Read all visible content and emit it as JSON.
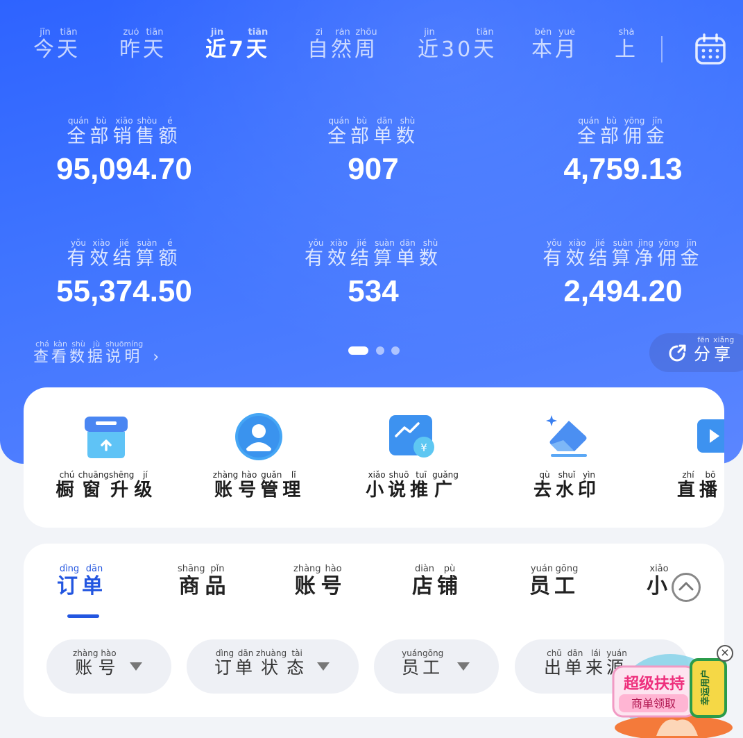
{
  "period_tabs": [
    {
      "label": "今天",
      "pinyin": [
        "jīn",
        "tiān"
      ]
    },
    {
      "label": "昨天",
      "pinyin": [
        "zuó",
        "tiān"
      ]
    },
    {
      "label": "近7天",
      "pinyin": [
        "jìn",
        "",
        "tiān"
      ]
    },
    {
      "label": "自然周",
      "pinyin": [
        "zì",
        "rán",
        "zhōu"
      ]
    },
    {
      "label": "近30天",
      "pinyin": [
        "jìn",
        "",
        "tiān"
      ]
    },
    {
      "label": "本月",
      "pinyin": [
        "běn",
        "yuè"
      ]
    },
    {
      "label": "上",
      "pinyin": [
        "shà"
      ]
    }
  ],
  "active_period": "近7天",
  "metrics": [
    {
      "label": "全部销售额",
      "pinyin": [
        "quán",
        "bù",
        "xiāo",
        "shòu",
        "é"
      ],
      "value": "95,094.70"
    },
    {
      "label": "全部单数",
      "pinyin": [
        "quán",
        "bù",
        "dān",
        "shù"
      ],
      "value": "907"
    },
    {
      "label": "全部佣金",
      "pinyin": [
        "quán",
        "bù",
        "yōng",
        "jīn"
      ],
      "value": "4,759.13"
    },
    {
      "label": "有效结算额",
      "pinyin": [
        "yǒu",
        "xiào",
        "jié",
        "suàn",
        "é"
      ],
      "value": "55,374.50"
    },
    {
      "label": "有效结算单数",
      "pinyin": [
        "yǒu",
        "xiào",
        "jié",
        "suàn",
        "dān",
        "shù"
      ],
      "value": "534"
    },
    {
      "label": "有效结算净佣金",
      "pinyin": [
        "yǒu",
        "xiào",
        "jié",
        "suàn",
        "jìng",
        "yōng",
        "jīn"
      ],
      "value": "2,494.20"
    }
  ],
  "data_note": {
    "label": "查看数据说明",
    "pinyin": [
      "chá",
      "kàn",
      "shù",
      "jù",
      "shuō",
      "míng"
    ]
  },
  "carousel": {
    "pages": 3,
    "current": 1
  },
  "share": {
    "label": "分享",
    "pinyin": [
      "fēn",
      "xiǎng"
    ]
  },
  "tools": [
    {
      "label": "橱窗升级",
      "pinyin": [
        "chú",
        "chuāng",
        "shēng",
        "jí"
      ],
      "icon": "shop-upgrade-icon"
    },
    {
      "label": "账号管理",
      "pinyin": [
        "zhàng",
        "hào",
        "guǎn",
        "lǐ"
      ],
      "icon": "account-icon"
    },
    {
      "label": "小说推广",
      "pinyin": [
        "xiǎo",
        "shuō",
        "tuī",
        "guǎng"
      ],
      "icon": "novel-promo-icon"
    },
    {
      "label": "去水印",
      "pinyin": [
        "qù",
        "shuǐ",
        "yìn"
      ],
      "icon": "eraser-icon"
    },
    {
      "label": "直播",
      "pinyin": [
        "zhí",
        "bō"
      ],
      "icon": "live-icon"
    }
  ],
  "order_tabs": [
    {
      "label": "订单",
      "pinyin": [
        "dìng",
        "dān"
      ]
    },
    {
      "label": "商品",
      "pinyin": [
        "shāng",
        "pǐn"
      ]
    },
    {
      "label": "账号",
      "pinyin": [
        "zhàng",
        "hào"
      ]
    },
    {
      "label": "店铺",
      "pinyin": [
        "diàn",
        "pù"
      ]
    },
    {
      "label": "员工",
      "pinyin": [
        "yuán",
        "gōng"
      ]
    },
    {
      "label": "小",
      "pinyin": [
        "xiǎo"
      ]
    }
  ],
  "filters": [
    {
      "label": "账号",
      "pinyin": [
        "zhàng",
        "hào"
      ]
    },
    {
      "label": "订单状态",
      "pinyin": [
        "dìng",
        "dān",
        "zhuàng",
        "tài"
      ]
    },
    {
      "label": "员工",
      "pinyin": [
        "yuán",
        "gōng"
      ]
    },
    {
      "label": "出单来源",
      "pinyin": [
        "chū",
        "dān",
        "lái",
        "yuán"
      ]
    }
  ],
  "promo": {
    "title": "超级扶持",
    "subtitle": "商单领取",
    "tag": "幸运用户"
  },
  "colors": {
    "hero": "#3a6cff",
    "accent": "#2356e0",
    "card": "#ffffff",
    "background": "#f2f4f8"
  }
}
